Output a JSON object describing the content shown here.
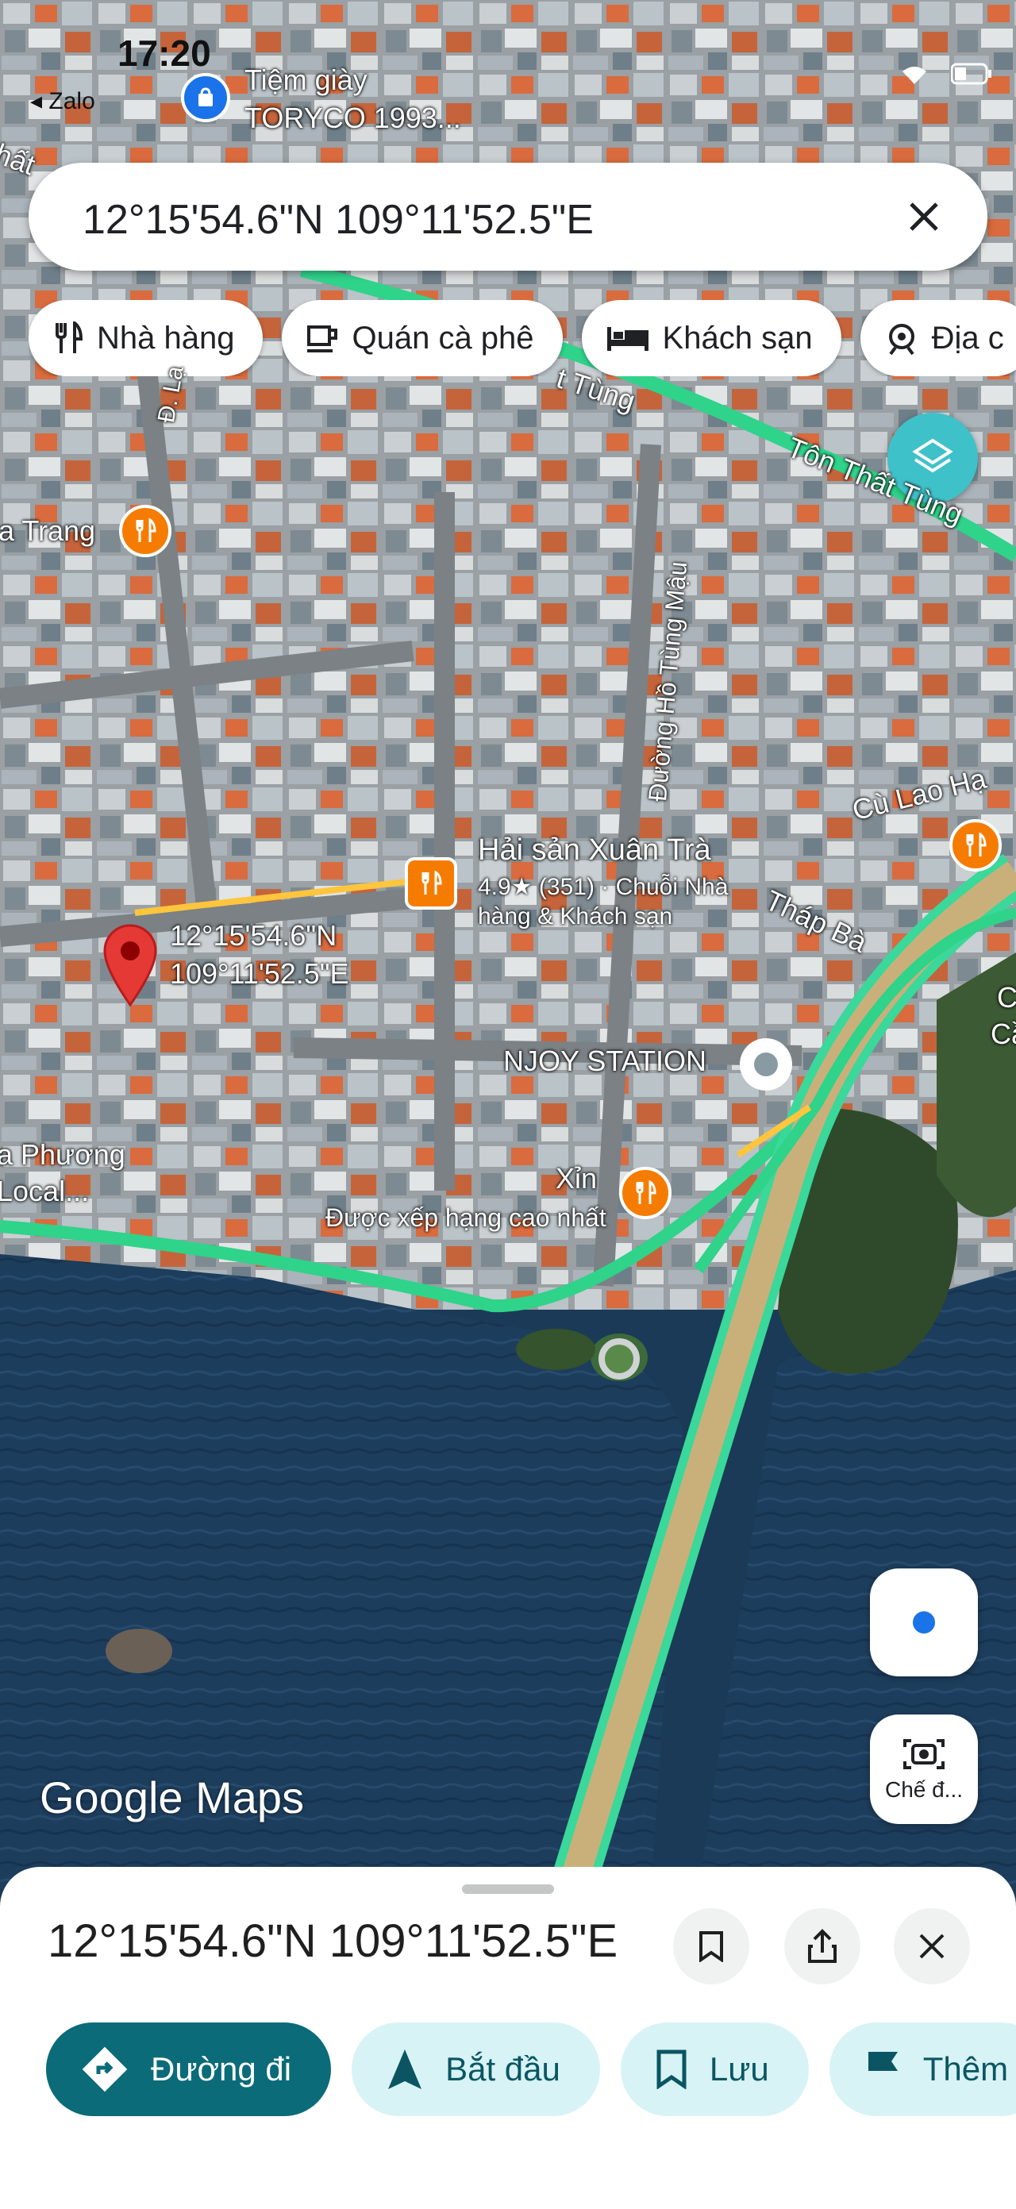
{
  "status_bar": {
    "time": "17:20",
    "back_app": "◂ Zalo"
  },
  "search": {
    "query": "12°15'54.6\"N 109°11'52.5\"E"
  },
  "category_chips": [
    {
      "label": "Nhà hàng",
      "icon": "fork-knife-icon"
    },
    {
      "label": "Quán cà phê",
      "icon": "coffee-cup-icon"
    },
    {
      "label": "Khách sạn",
      "icon": "bed-icon"
    },
    {
      "label": "Địa c",
      "icon": "landmark-icon"
    }
  ],
  "map": {
    "top_poi": {
      "line1": "Tiệm giày",
      "line2": "TORYCO 1993..."
    },
    "streets": {
      "ton_that_tung_1": "Tôn Thất Tùng",
      "ton_that_tung_2": "t Tùng",
      "ho_tung_mau": "Đường Hồ Tùng Mậu",
      "cu_lao_ha": "Cù Lao Hạ",
      "thap_ba": "Tháp Bà",
      "la": "Đ. Lạ",
      "nhat": "hất"
    },
    "place_a_trang": "a Trang",
    "restaurant": {
      "name": "Hải sản Xuân Trà",
      "info": "4.9★ (351) · Chuỗi Nhà",
      "info2": "hàng & Khách sạn"
    },
    "pin_label": {
      "line1": "12°15'54.6\"N",
      "line2": "109°11'52.5\"E"
    },
    "njoy": "NJOY STATION",
    "xin": {
      "name": "Xỉn",
      "sub": "Được xếp hạng cao nhất"
    },
    "phuong": {
      "line1": "a Phương",
      "line2": "Local..."
    },
    "right_edge": {
      "c1": "C",
      "c2": "Cầ"
    },
    "google_logo": "Google Maps"
  },
  "camera_fab": {
    "label": "Chế đ..."
  },
  "sheet": {
    "title": "12°15'54.6\"N 109°11'52.5\"E",
    "actions": [
      {
        "label": "Đường đi",
        "icon": "directions-icon"
      },
      {
        "label": "Bắt đầu",
        "icon": "navigation-arrow-icon"
      },
      {
        "label": "Lưu",
        "icon": "bookmark-icon"
      },
      {
        "label": "Thêm",
        "icon": "flag-icon"
      }
    ]
  },
  "colors": {
    "accent": "#0b6b78",
    "chip_tint": "#d7f3f5",
    "poi": "#f57c00",
    "pin": "#e53935",
    "road_green": "#2fd38a"
  }
}
